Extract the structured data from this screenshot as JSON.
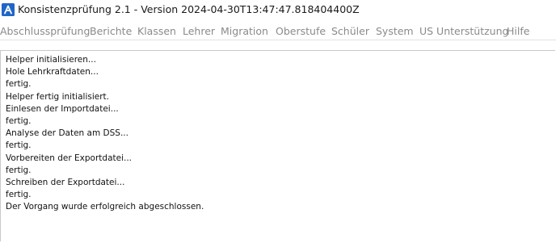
{
  "window": {
    "title": "Konsistenzprüfung 2.1 - Version 2024-04-30T13:47:47.818404400Z",
    "icon": "app-logo-icon",
    "colors": {
      "icon_bg": "#1f66c7",
      "menu_text": "#8a8a8a"
    }
  },
  "menu": {
    "items": [
      {
        "label": "Abschlussprüfung"
      },
      {
        "label": "Berichte"
      },
      {
        "label": "Klassen"
      },
      {
        "label": "Lehrer"
      },
      {
        "label": "Migration"
      },
      {
        "label": "Oberstufe"
      },
      {
        "label": "Schüler"
      },
      {
        "label": "System"
      },
      {
        "label": "US Unterstützung"
      },
      {
        "label": "Hilfe"
      }
    ]
  },
  "log": {
    "lines": [
      "Helper initialisieren...",
      "Hole Lehrkraftdaten...",
      "fertig.",
      "Helper fertig initialisiert.",
      "Einlesen der Importdatei...",
      "fertig.",
      "Analyse der Daten am DSS...",
      "fertig.",
      "Vorbereiten der Exportdatei...",
      "fertig.",
      "Schreiben der Exportdatei...",
      "fertig.",
      "Der Vorgang wurde erfolgreich abgeschlossen."
    ]
  }
}
